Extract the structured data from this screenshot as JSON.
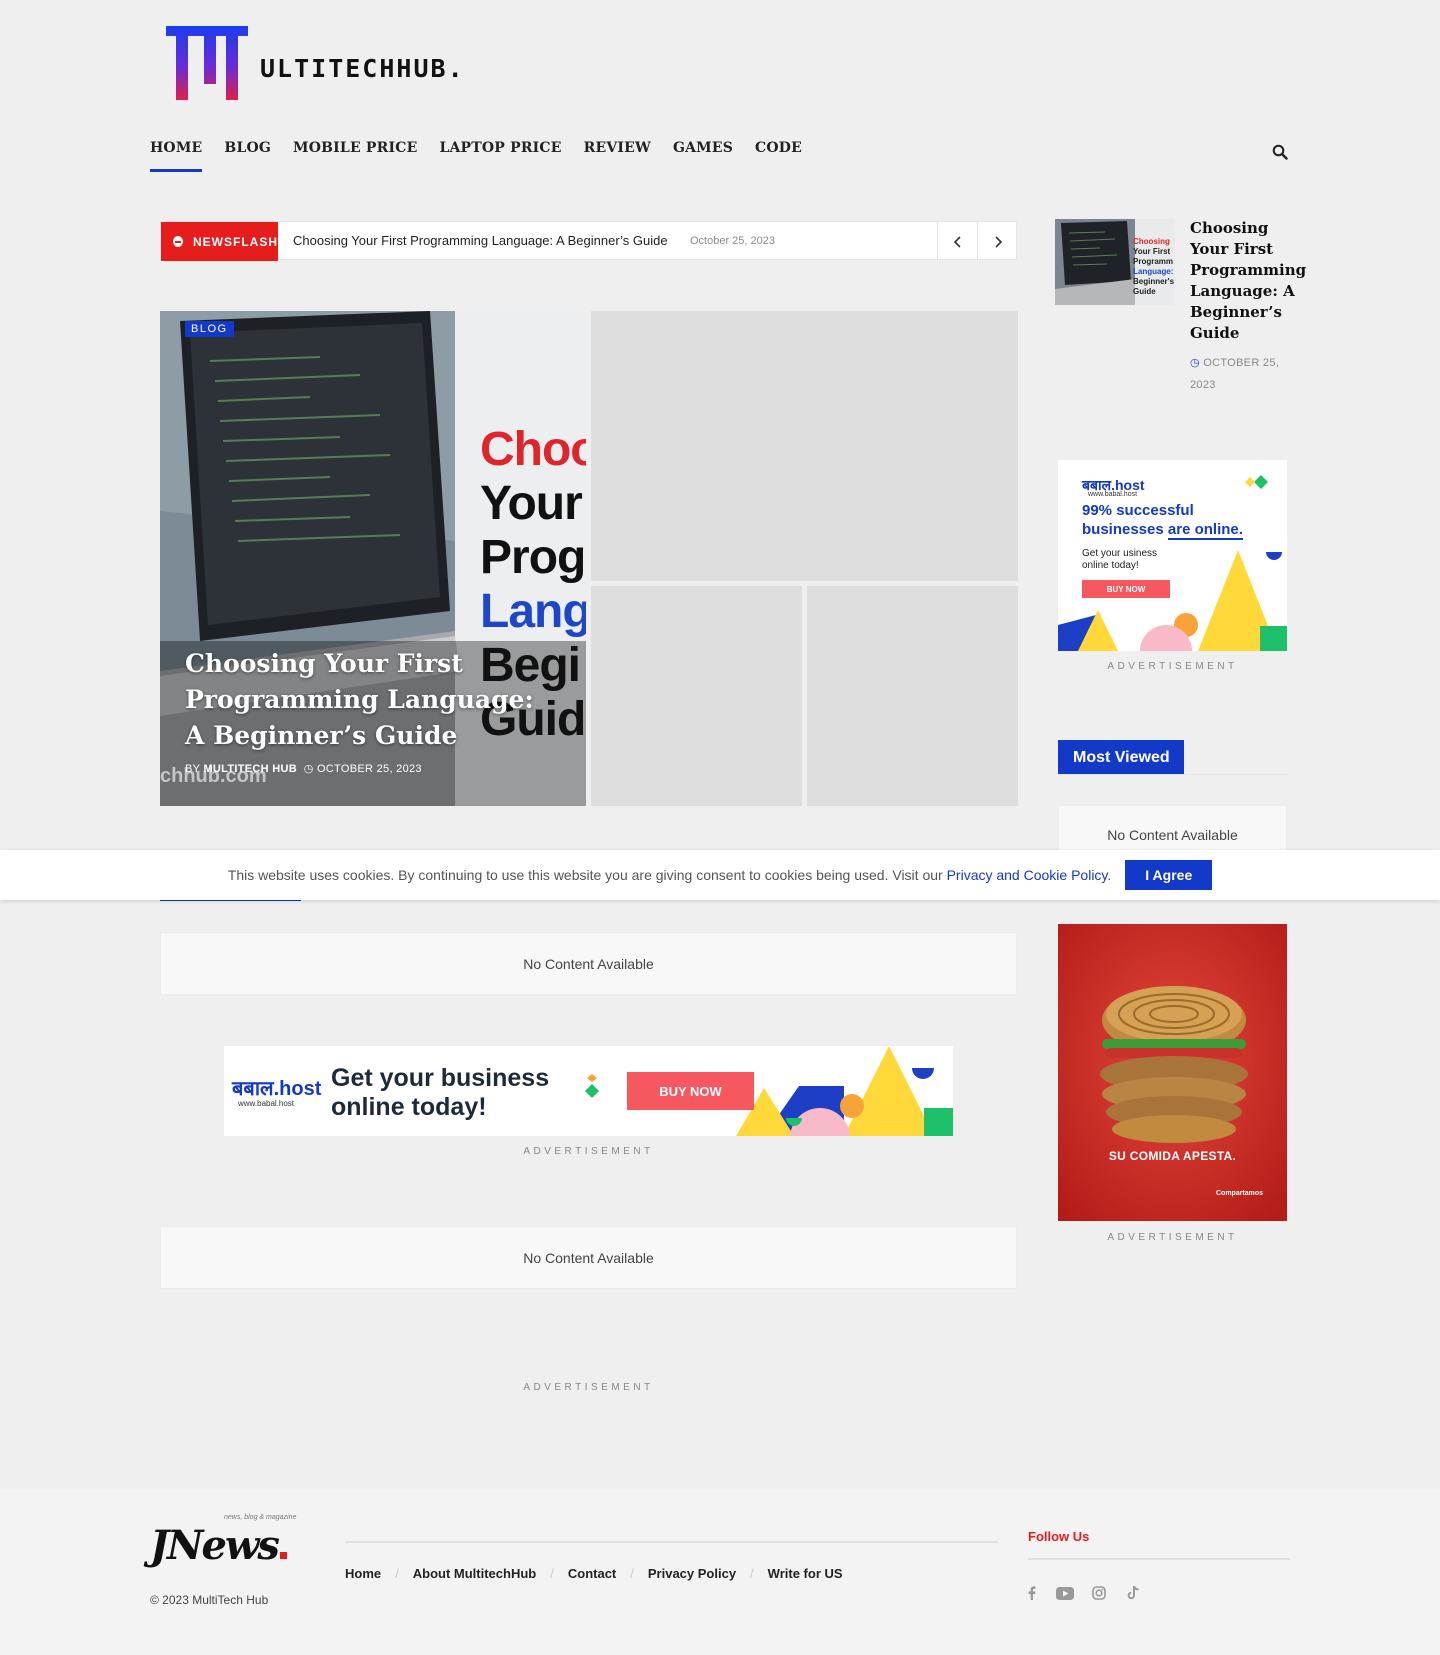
{
  "logo": {
    "text": "ULTITECHHUB."
  },
  "nav": {
    "items": [
      "HOME",
      "BLOG",
      "MOBILE PRICE",
      "LAPTOP PRICE",
      "REVIEW",
      "GAMES",
      "CODE"
    ]
  },
  "newsflash": {
    "badge": "NEWSFLASH",
    "title": "Choosing Your First Programming Language: A Beginner’s Guide",
    "date": "October 25, 2023"
  },
  "hero": {
    "tag": "BLOG",
    "title": "Choosing Your First Programming Language: A Beginner’s Guide",
    "by": "BY",
    "author": "MULTITECH HUB",
    "date": "OCTOBER 25, 2023",
    "watermark": "chhub.com",
    "image_text": [
      "Choo",
      "Your",
      "Prog",
      "Lang",
      "Begi",
      "Guid"
    ]
  },
  "sidebar": {
    "post": {
      "title": "Choosing Your First Programming Language: A Beginner’s Guide",
      "date": "OCTOBER 25, 2023",
      "thumb_text": [
        "Choosing",
        "Your First",
        "Programm",
        "Language:",
        "Beginner's",
        "Guide"
      ]
    },
    "ad1": {
      "brand": "बबाल.host",
      "site": "www.babal.host",
      "line1": "99% successful",
      "line2a": "businesses ",
      "line2b": "are online.",
      "sub1": "Get your usiness",
      "sub2": "online today!",
      "cta": "BUY NOW"
    },
    "ad_label": "ADVERTISEMENT",
    "most_viewed": "Most Viewed",
    "no_content": "No Content Available",
    "ad2": {
      "headline": "SU COMIDA APESTA.",
      "brand": "Compartamos"
    }
  },
  "main": {
    "no_content_1": "No Content Available",
    "no_content_2": "No Content Available",
    "ad_banner": {
      "brand": "बबाल.host",
      "site": "www.babal.host",
      "line1": "Get your business",
      "line2": "online today!",
      "cta": "BUY NOW"
    },
    "ad_label": "ADVERTISEMENT"
  },
  "cookie": {
    "text": "This website uses cookies. By continuing to use this website you are giving consent to cookies being used. Visit our",
    "link": "Privacy and Cookie Policy",
    "suffix": ".",
    "button": "I Agree"
  },
  "footer": {
    "logo": "JNews",
    "logo_tagline": "news, blog & magazine",
    "copyright": "© 2023 MultiTech Hub",
    "links": [
      "Home",
      "About MultitechHub",
      "Contact",
      "Privacy Policy",
      "Write for US"
    ],
    "follow": "Follow Us",
    "social": [
      "facebook-icon",
      "youtube-icon",
      "instagram-icon",
      "tiktok-icon"
    ]
  },
  "colors": {
    "accent": "#1339c9",
    "red": "#e51d1d",
    "bg": "#efefef"
  }
}
